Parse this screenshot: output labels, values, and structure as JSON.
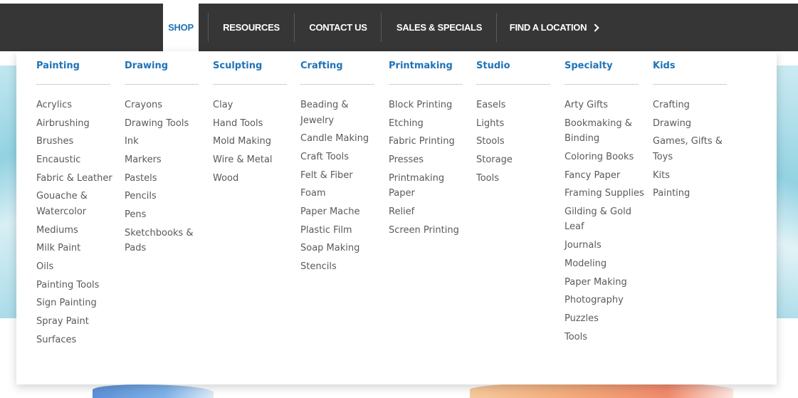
{
  "nav": {
    "items": [
      {
        "label": "SHOP"
      },
      {
        "label": "RESOURCES"
      },
      {
        "label": "CONTACT US"
      },
      {
        "label": "SALES & SPECIALS"
      },
      {
        "label": "FIND A LOCATION"
      }
    ],
    "active": "SHOP",
    "find_icon": "chevron-right-icon"
  },
  "menu": {
    "columns": [
      {
        "title": "Painting",
        "items": [
          "Acrylics",
          "Airbrushing",
          "Brushes",
          "Encaustic",
          "Fabric & Leather",
          "Gouache & Watercolor",
          "Mediums",
          "Milk Paint",
          "Oils",
          "Painting Tools",
          "Sign Painting",
          "Spray Paint",
          "Surfaces"
        ]
      },
      {
        "title": "Drawing",
        "items": [
          "Crayons",
          "Drawing Tools",
          "Ink",
          "Markers",
          "Pastels",
          "Pencils",
          "Pens",
          "Sketchbooks & Pads"
        ]
      },
      {
        "title": "Sculpting",
        "items": [
          "Clay",
          "Hand Tools",
          "Mold Making",
          "Wire & Metal",
          "Wood"
        ]
      },
      {
        "title": "Crafting",
        "items": [
          "Beading & Jewelry",
          "Candle Making",
          "Craft Tools",
          "Felt & Fiber",
          "Foam",
          "Paper Mache",
          "Plastic Film",
          "Soap Making",
          "Stencils"
        ]
      },
      {
        "title": "Printmaking",
        "items": [
          "Block Printing",
          "Etching",
          "Fabric Printing",
          "Presses",
          "Printmaking Paper",
          "Relief",
          "Screen Printing"
        ]
      },
      {
        "title": "Studio",
        "items": [
          "Easels",
          "Lights",
          "Stools",
          "Storage",
          "Tools"
        ]
      },
      {
        "title": "Specialty",
        "items": [
          "Arty Gifts",
          "Bookmaking & Binding",
          "Coloring Books",
          "Fancy Paper",
          "Framing Supplies",
          "Gilding & Gold Leaf",
          "Journals",
          "Modeling",
          "Paper Making",
          "Photography",
          "Puzzles",
          "Tools"
        ]
      },
      {
        "title": "Kids",
        "items": [
          "Crafting",
          "Drawing",
          "Games, Gifts & Toys",
          "Kits",
          "Painting"
        ]
      }
    ]
  },
  "colors": {
    "navbar": "#363636",
    "accent": "#1f73b7",
    "link": "#5a5a5a"
  }
}
